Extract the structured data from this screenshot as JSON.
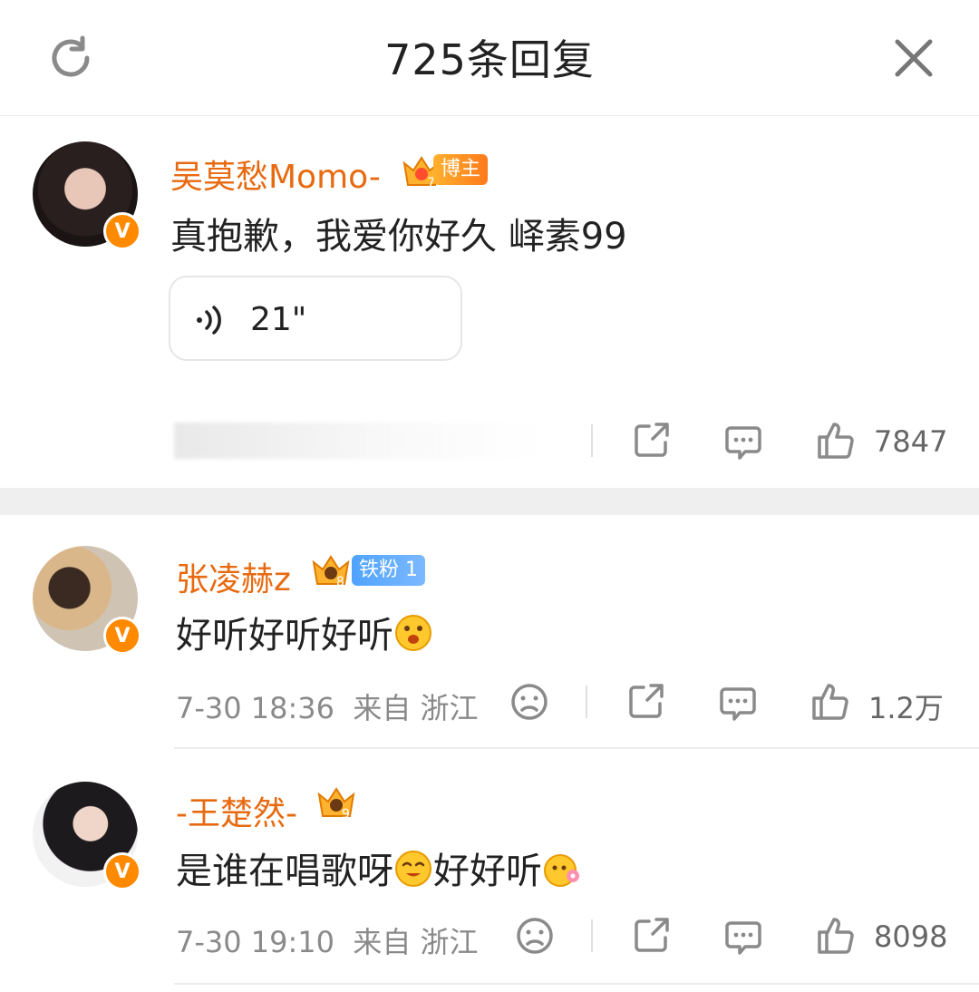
{
  "header": {
    "title": "725条回复",
    "refresh_icon": "refresh-icon",
    "close_icon": "close-icon"
  },
  "pinned": {
    "username": "吴莫愁Momo-",
    "role_tag": "博主",
    "crown_level": "7",
    "text": "真抱歉，我爱你好久 峄素99",
    "voice_duration": "21\"",
    "likes": "7847"
  },
  "comments": [
    {
      "username": "张凌赫z",
      "fan_tag": "铁粉 1",
      "crown_level": "8",
      "text": "好听好听好听",
      "time": "7-30 18:36",
      "location": "来自 浙江",
      "likes": "1.2万"
    },
    {
      "username": "-王楚然-",
      "crown_level": "9",
      "text_a": "是谁在唱歌呀",
      "text_b": "好好听",
      "time": "7-30 19:10",
      "location": "来自 浙江",
      "likes": "8098"
    }
  ],
  "colors": {
    "username": "#e86a10",
    "verified": "#ff8a00",
    "tiefen": "#4fa3ff"
  }
}
